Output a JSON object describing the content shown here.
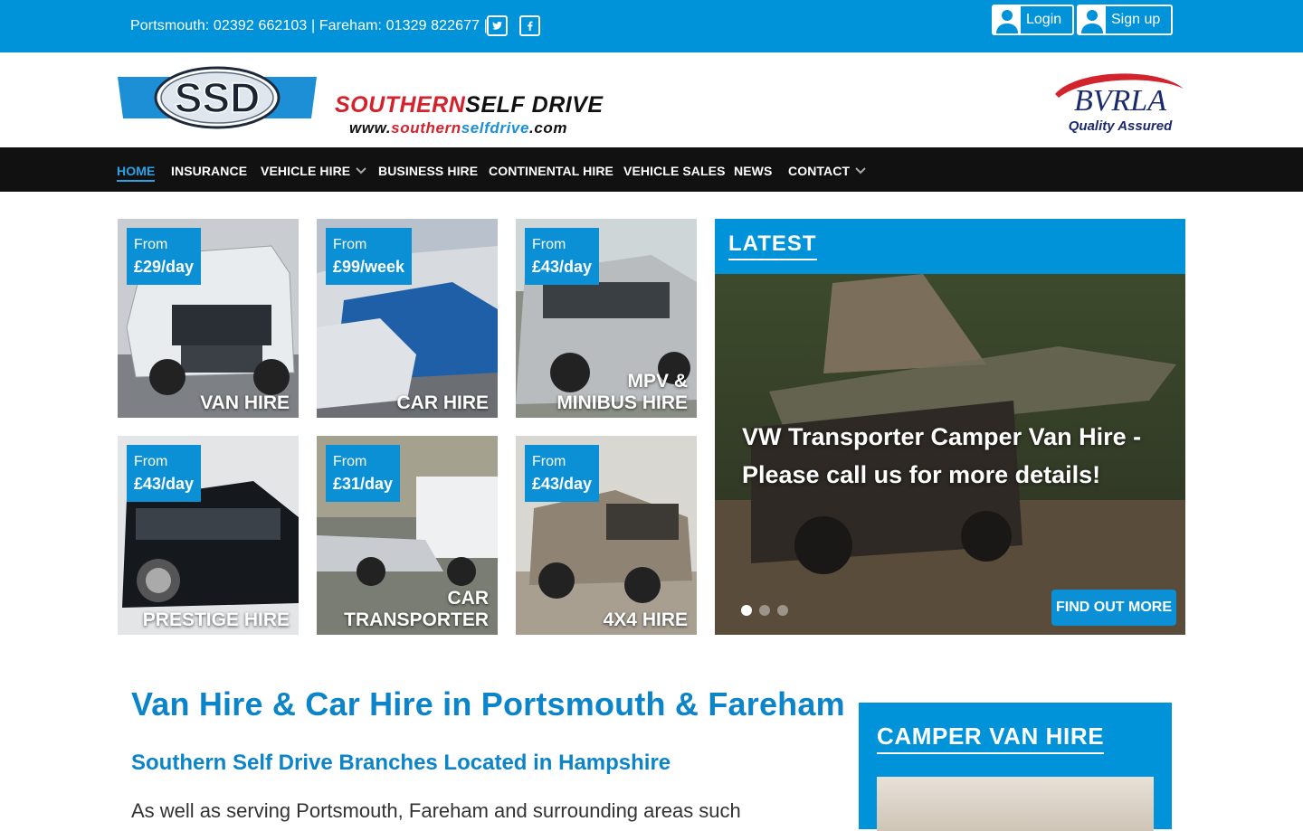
{
  "topbar": {
    "phones": "Portsmouth: 02392 662103 | Fareham: 01329 822677 |",
    "social": [
      "twitter-icon",
      "facebook-icon"
    ],
    "login": "Login",
    "signup": "Sign up"
  },
  "header": {
    "logo_text": "SSD",
    "brand_part1": "SOUTHERN",
    "brand_part2": "SELF DRIVE",
    "url_prefix": "www.",
    "url_red": "southern",
    "url_blue": "selfdrive",
    "url_suffix": ".com",
    "bvrla_name": "BVRLA",
    "bvrla_tag": "Quality Assured"
  },
  "nav": [
    {
      "label": "HOME",
      "active": true
    },
    {
      "label": "INSURANCE"
    },
    {
      "label": "VEHICLE HIRE",
      "dropdown": true
    },
    {
      "label": "BUSINESS HIRE"
    },
    {
      "label": "CONTINENTAL HIRE"
    },
    {
      "label": "VEHICLE SALES"
    },
    {
      "label": "NEWS"
    },
    {
      "label": "CONTACT",
      "dropdown": true
    }
  ],
  "tiles": [
    {
      "from": "From",
      "price": "£29/day",
      "label1": "VAN HIRE",
      "label2": ""
    },
    {
      "from": "From",
      "price": "£99/week",
      "label1": "CAR HIRE",
      "label2": ""
    },
    {
      "from": "From",
      "price": "£43/day",
      "label1": "MPV &",
      "label2": "MINIBUS HIRE"
    },
    {
      "from": "From",
      "price": "£43/day",
      "label1": "PRESTIGE HIRE",
      "label2": ""
    },
    {
      "from": "From",
      "price": "£31/day",
      "label1": "CAR",
      "label2": "TRANSPORTER"
    },
    {
      "from": "From",
      "price": "£43/day",
      "label1": "4X4 HIRE",
      "label2": ""
    }
  ],
  "latest": {
    "title": "LATEST",
    "caption": "VW Transporter Camper Van Hire - Please call us for more details!",
    "button": "FIND OUT MORE",
    "slide_index": 1,
    "slide_count": 3
  },
  "main": {
    "title": "Van Hire & Car Hire in Portsmouth & Fareham",
    "subtitle": "Southern Self Drive Branches Located in Hampshire",
    "paragraph": "As well as serving Portsmouth, Fareham and surrounding areas such"
  },
  "sidebar": {
    "title": "CAMPER VAN HIRE"
  },
  "colors": {
    "brand_blue": "#0093d9",
    "nav_bg": "#111111",
    "heading_blue": "#0b84c9",
    "brand_red": "#d3232c"
  }
}
